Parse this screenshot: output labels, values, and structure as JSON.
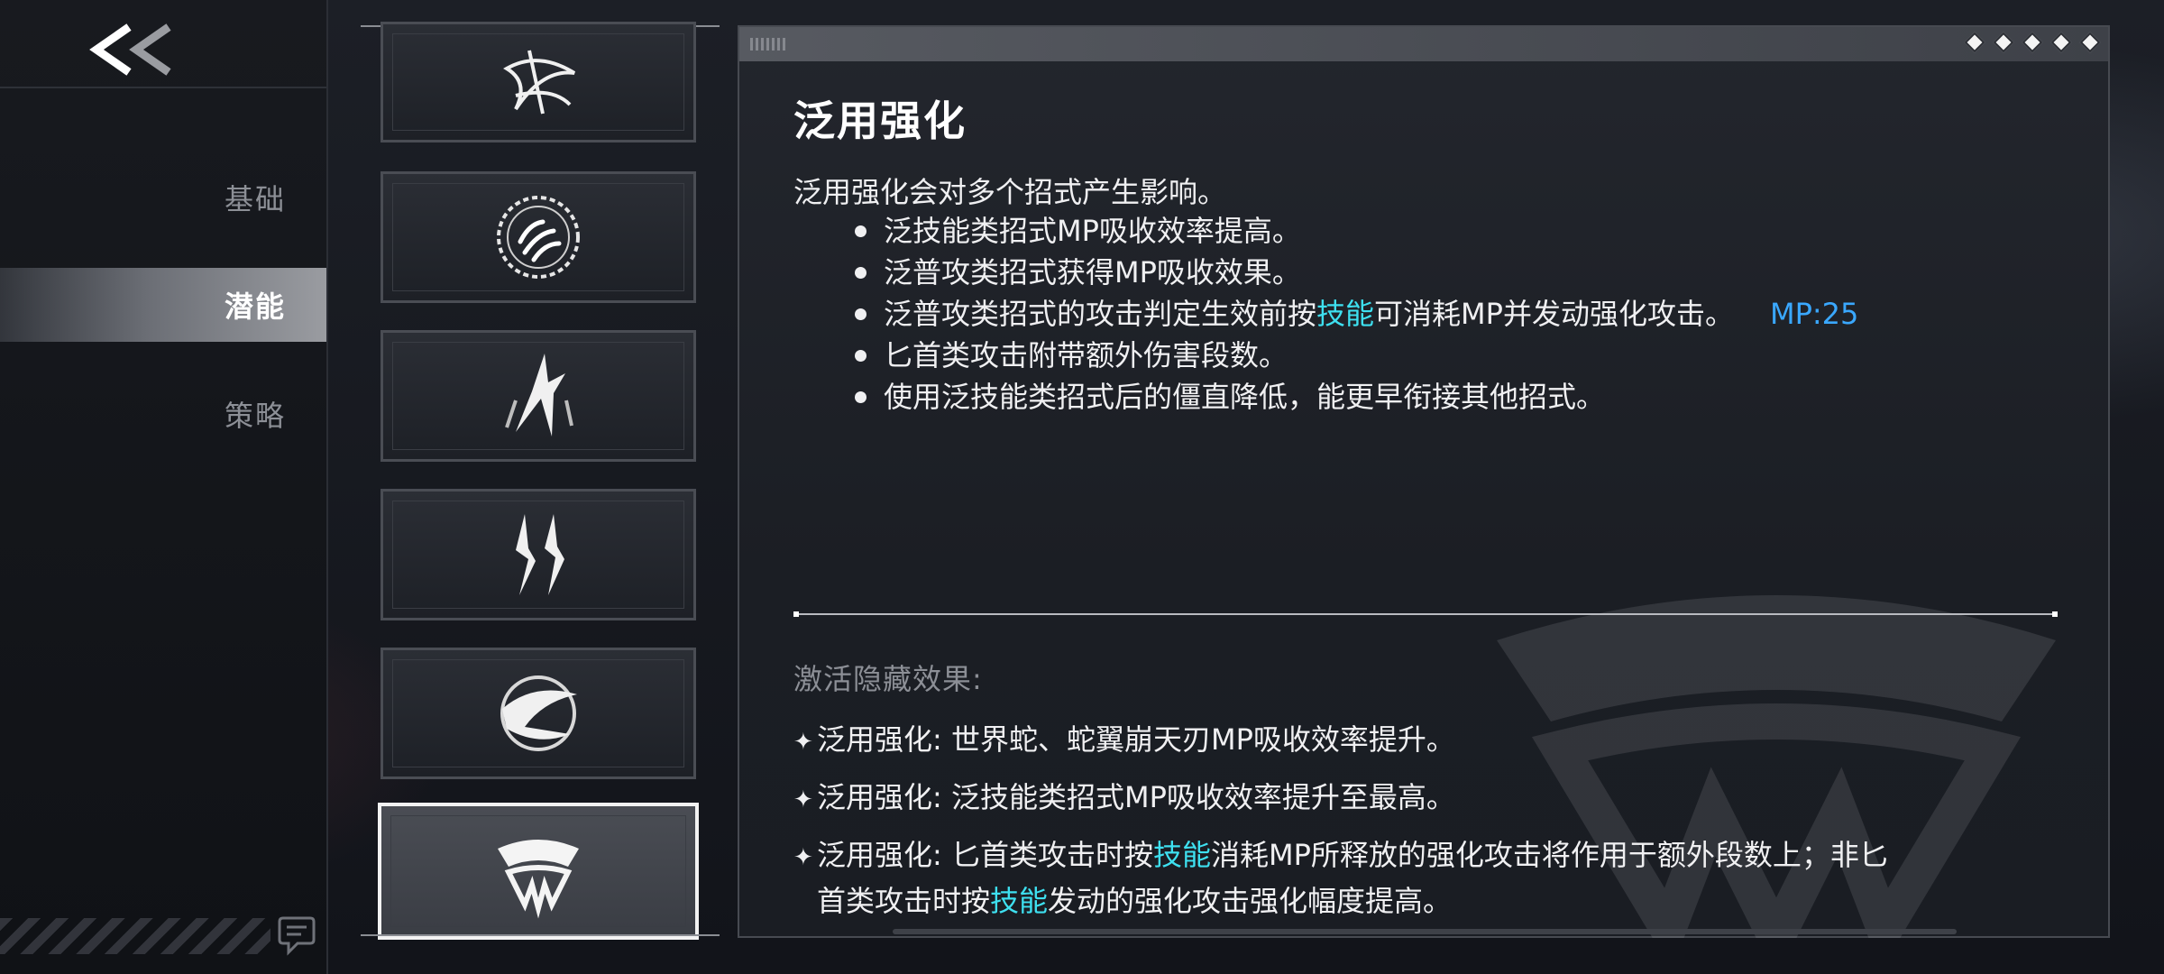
{
  "nav": {
    "items": [
      {
        "label": "基础",
        "active": false
      },
      {
        "label": "潜能",
        "active": true
      },
      {
        "label": "策略",
        "active": false
      }
    ]
  },
  "skills": [
    {
      "icon": "spiral-star-icon",
      "selected": false
    },
    {
      "icon": "ringed-claw-icon",
      "selected": false
    },
    {
      "icon": "blade-flare-icon",
      "selected": false
    },
    {
      "icon": "twin-claw-icon",
      "selected": false
    },
    {
      "icon": "orbit-blade-icon",
      "selected": false
    },
    {
      "icon": "serpent-crest-icon",
      "selected": true
    }
  ],
  "detail": {
    "title": "泛用强化",
    "intro": "泛用强化会对多个招式产生影响。",
    "effects": {
      "e1": "泛技能类招式MP吸收效率提高。",
      "e2": "泛普攻类招式获得MP吸收效果。",
      "e3_pre": "泛普攻类招式的攻击判定生效前按",
      "e3_kw": "技能",
      "e3_post": "可消耗MP并发动强化攻击。",
      "e3_mp": "MP:25",
      "e4": "匕首类攻击附带额外伤害段数。",
      "e5": "使用泛技能类招式后的僵直降低，能更早衔接其他招式。"
    },
    "hidden_title": "激活隐藏效果:",
    "hidden": {
      "h1": "泛用强化: 世界蛇、蛇翼崩天刃MP吸收效率提升。",
      "h2": "泛用强化: 泛技能类招式MP吸收效率提升至最高。",
      "h3_a": "泛用强化: 匕首类攻击时按",
      "h3_kw1": "技能",
      "h3_b": "消耗MP所释放的强化攻击将作用于额外段数上；非匕",
      "h3_c": "首类攻击时按",
      "h3_kw2": "技能",
      "h3_d": "发动的强化攻击强化幅度提高。"
    },
    "star_glyph": "✦"
  },
  "colors": {
    "keyword": "#3ee0f0",
    "mp": "#3aa8ff"
  }
}
